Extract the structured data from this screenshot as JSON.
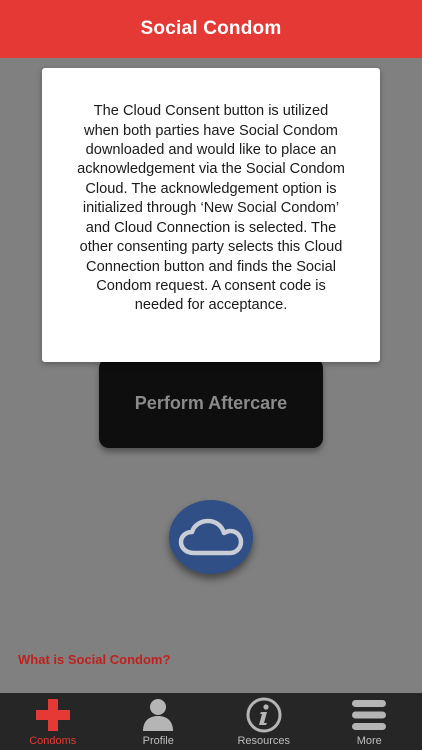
{
  "header": {
    "title": "Social Condom"
  },
  "main": {
    "perform_button_label": "Perform Aftercare",
    "cloud_button_icon": "cloud-icon",
    "what_is_link": "What is Social Condom?"
  },
  "modal": {
    "lines": [
      "The Cloud Consent button is utilized",
      "when both parties have Social Condom",
      "downloaded and would like to place an",
      "acknowledgement via the Social Condom",
      "Cloud. The acknowledgement option is",
      "initialized through ‘New Social Condom’",
      "and Cloud Connection is selected. The",
      "other consenting party selects this Cloud",
      "Connection button and finds the Social",
      "Condom request. A consent code is",
      "needed for acceptance."
    ]
  },
  "tabs": [
    {
      "label": "Condoms",
      "icon": "red-cross-icon",
      "active": true
    },
    {
      "label": "Profile",
      "icon": "person-icon",
      "active": false
    },
    {
      "label": "Resources",
      "icon": "info-icon",
      "active": false
    },
    {
      "label": "More",
      "icon": "menu-icon",
      "active": false
    }
  ],
  "colors": {
    "brand_red": "#e53935",
    "overlay_gray": "#808080",
    "cloud_blue": "#2f4f86",
    "tab_bar": "#262626"
  }
}
